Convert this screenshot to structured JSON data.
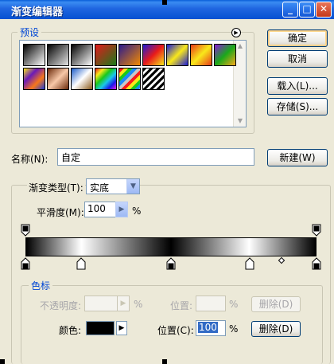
{
  "window": {
    "title": "渐变编辑器"
  },
  "buttons": {
    "ok": "确定",
    "cancel": "取消",
    "load": "载入(L)...",
    "save": "存储(S)...",
    "new": "新建(W)",
    "delete_opacity": "删除(D)",
    "delete_color": "删除(D)"
  },
  "presets": {
    "label": "预设",
    "swatches": [
      {
        "name": "foreground-to-background",
        "gradient": "linear-gradient(135deg,#000,#fff)"
      },
      {
        "name": "foreground-to-transparent",
        "gradient": "linear-gradient(135deg,#000,rgba(0,0,0,0.1))"
      },
      {
        "name": "black-white",
        "gradient": "linear-gradient(135deg,#000,#fff)"
      },
      {
        "name": "red-green",
        "gradient": "linear-gradient(135deg,#E31A1C,#1A7A1A)"
      },
      {
        "name": "violet-orange",
        "gradient": "linear-gradient(135deg,#2A1A8E,#F28A00)"
      },
      {
        "name": "blue-red-yellow",
        "gradient": "linear-gradient(135deg,#1A1AD8,#E81A1A,#F8E81A)"
      },
      {
        "name": "blue-yellow-blue",
        "gradient": "linear-gradient(135deg,#1A1AD8,#F8E81A,#1A1AD8)"
      },
      {
        "name": "orange-yellow-orange",
        "gradient": "linear-gradient(135deg,#E83A1A,#F8E81A,#E83A1A)"
      },
      {
        "name": "violet-green-orange",
        "gradient": "linear-gradient(135deg,#8A1AD8,#1AA81A,#F8A81A)"
      },
      {
        "name": "yellow-violet-orange-blue",
        "gradient": "linear-gradient(135deg,#F8E81A,#6A1AB8,#F8781A,#1A3AD8)"
      },
      {
        "name": "copper",
        "gradient": "linear-gradient(135deg,#6A2A0A,#F8C8A8,#6A2A0A)"
      },
      {
        "name": "chrome",
        "gradient": "linear-gradient(135deg,#1A5AC8,#FFFFFF,#8A5A1A)"
      },
      {
        "name": "spectrum",
        "gradient": "linear-gradient(135deg,#E81A1A,#F8E81A,#1AC81A,#1AC8E8,#1A1AE8,#E81AE8)"
      },
      {
        "name": "transparent-rainbow",
        "gradient": "repeating-linear-gradient(135deg,#F81A1A 0 4px,#F8E81A 4px 8px,#1AC81A 8px 12px,#1A8AF8 12px 16px,#C8C8C8 16px 20px)"
      },
      {
        "name": "transparent-stripes",
        "gradient": "repeating-linear-gradient(135deg,#000 0 3px,#fff 3px 6px)"
      }
    ]
  },
  "name_field": {
    "label": "名称(N):",
    "value": "自定"
  },
  "gradient_type": {
    "label": "渐变类型(T):",
    "value": "实底"
  },
  "smoothness": {
    "label": "平滑度(M):",
    "value": "100",
    "unit": "%"
  },
  "color_stops_group": {
    "label": "色标",
    "opacity_label": "不透明度:",
    "opacity_unit": "%",
    "opacity_location_label": "位置:",
    "opacity_location_unit": "%",
    "color_label": "颜色:",
    "color_value": "#000000",
    "location_label": "位置(C):",
    "location_value": "100",
    "location_unit": "%"
  },
  "gradient_stops": {
    "opacity_stops": [
      0,
      100
    ],
    "color_stops": [
      {
        "location": 0,
        "color": "#000000"
      },
      {
        "location": 19,
        "color": "#FFFFFF"
      },
      {
        "location": 50,
        "color": "#000000"
      },
      {
        "location": 77,
        "color": "#FFFFFF"
      },
      {
        "location": 100,
        "color": "#000000"
      }
    ]
  },
  "colors": {
    "title_bar": "#0A5FD8",
    "group_label": "#0046D5",
    "selection": "#316AC5"
  }
}
